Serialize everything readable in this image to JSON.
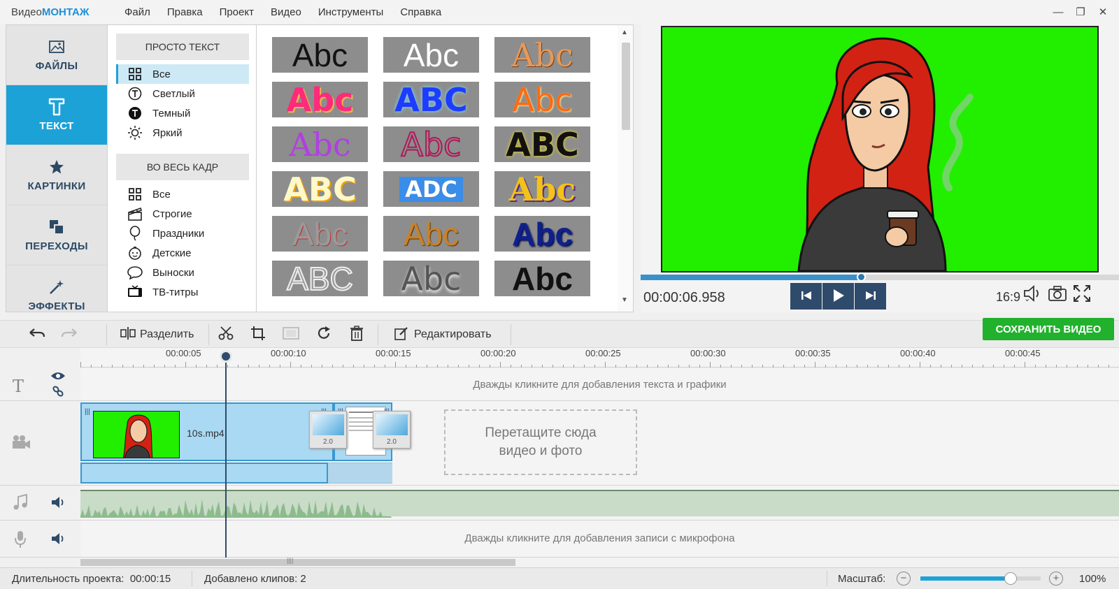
{
  "app": {
    "logo_pre": "Видео",
    "logo_bold": "МОНТАЖ"
  },
  "menu": [
    "Файл",
    "Правка",
    "Проект",
    "Видео",
    "Инструменты",
    "Справка"
  ],
  "window_controls": {
    "minimize": "—",
    "maximize": "❐",
    "close": "✕"
  },
  "sidebar": [
    {
      "label": "ФАЙЛЫ",
      "icon": "image-icon"
    },
    {
      "label": "ТЕКСТ",
      "icon": "text-t-icon",
      "active": true
    },
    {
      "label": "КАРТИНКИ",
      "icon": "star-icon"
    },
    {
      "label": "ПЕРЕХОДЫ",
      "icon": "transitions-icon"
    },
    {
      "label": "ЭФФЕКТЫ",
      "icon": "magic-wand-icon"
    }
  ],
  "categories": {
    "group1_title": "ПРОСТО ТЕКСТ",
    "group1": [
      "Все",
      "Светлый",
      "Темный",
      "Яркий"
    ],
    "group2_title": "ВО ВЕСЬ КАДР",
    "group2": [
      "Все",
      "Строгие",
      "Праздники",
      "Детские",
      "Выноски",
      "ТВ-титры"
    ]
  },
  "gallery": {
    "tiles": [
      "Abc",
      "Abc",
      "Abc",
      "Abc",
      "ABC",
      "Abc",
      "Abc",
      "Abc",
      "ABC",
      "ABC",
      "ADC",
      "Abc",
      "Abc",
      "Abc",
      "Abc",
      "ABC",
      "Abc",
      "Abc"
    ]
  },
  "player": {
    "timecode": "00:00:06.958",
    "aspect": "16:9",
    "progress": 0.46
  },
  "toolbar": {
    "split": "Разделить",
    "edit": "Редактировать",
    "save": "СОХРАНИТЬ ВИДЕО"
  },
  "timeline": {
    "ruler": [
      "00:00:05",
      "00:00:10",
      "00:00:15",
      "00:00:20",
      "00:00:25",
      "00:00:30",
      "00:00:35",
      "00:00:40",
      "00:00:45"
    ],
    "text_hint": "Дважды кликните для добавления текста и графики",
    "clip_name": "10s.mp4",
    "transition_1": "2.0",
    "transition_2": "2.0",
    "drop_hint_1": "Перетащите сюда",
    "drop_hint_2": "видео и фото",
    "mic_hint": "Дважды кликните для добавления записи с микрофона"
  },
  "status": {
    "duration_label": "Длительность проекта:",
    "duration": "00:00:15",
    "clips_label": "Добавлено клипов:",
    "clips": "2",
    "zoom_label": "Масштаб:",
    "zoom_minus": "−",
    "zoom_plus": "+",
    "zoom": "100%",
    "zoom_level": 0.75
  },
  "colors": {
    "accent": "#1da2d8",
    "save": "#21b12d",
    "greenscreen": "#22ee00"
  }
}
